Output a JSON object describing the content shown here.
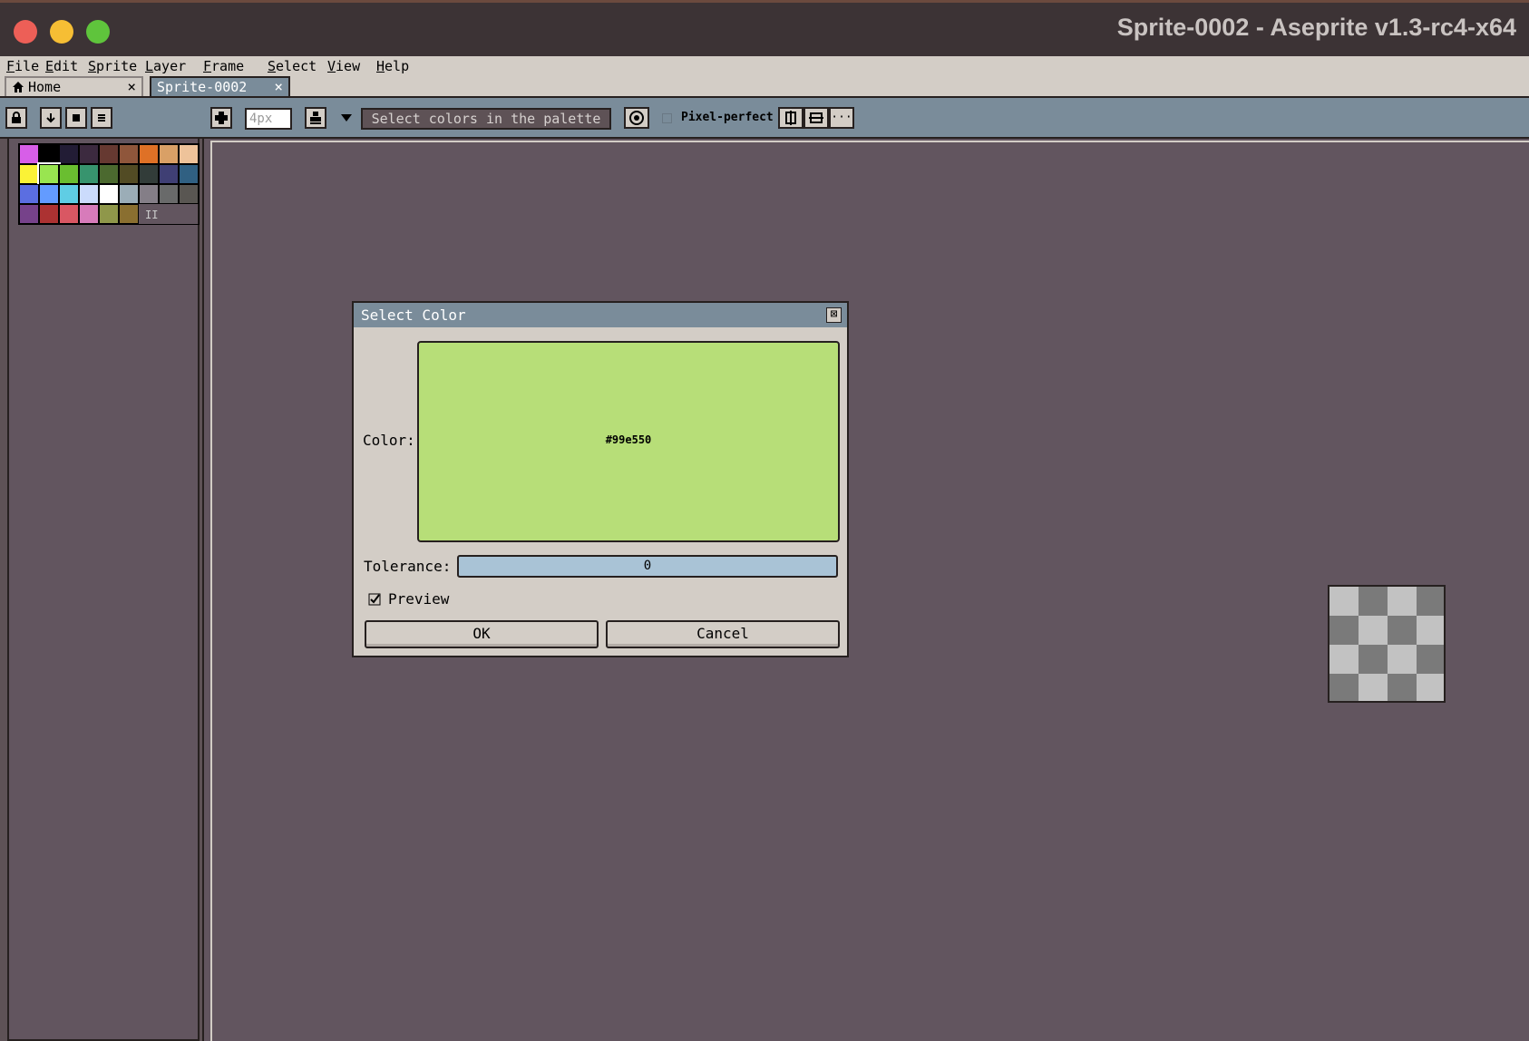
{
  "window": {
    "title": "Sprite-0002 - Aseprite v1.3-rc4-x64",
    "traffic_colors": {
      "close": "#ed5f57",
      "minimize": "#f6be34",
      "maximize": "#5fc43c"
    }
  },
  "menu": {
    "items": [
      "File",
      "Edit",
      "Sprite",
      "Layer",
      "Frame",
      "Select",
      "View",
      "Help"
    ]
  },
  "tabs": [
    {
      "label": "Home",
      "close": "×"
    },
    {
      "label": "Sprite-0002",
      "close": "×"
    }
  ],
  "toolbar": {
    "brush_size_placeholder": "4px",
    "pick_mode": "Select colors in the palette",
    "pixel_perfect_label": "Pixel-perfect",
    "more_label": "···"
  },
  "palette": {
    "colors": [
      "#d75ee8",
      "#000000",
      "#221c35",
      "#3c2a3f",
      "#663931",
      "#8f563b",
      "#df7126",
      "#d9a066",
      "#eec39a",
      "#fbf236",
      "#99e550",
      "#6abe30",
      "#37946e",
      "#4b692f",
      "#524b24",
      "#323c39",
      "#3f3f74",
      "#306082",
      "#5b6ee1",
      "#639bff",
      "#5fcde4",
      "#cbdbfc",
      "#ffffff",
      "#9badb7",
      "#847e87",
      "#696a6a",
      "#595652",
      "#76428a",
      "#ac3232",
      "#d95763",
      "#d77bba",
      "#8f974a",
      "#8a6f30"
    ],
    "more_indicator": "II"
  },
  "dialog": {
    "title": "Select Color",
    "color_label": "Color:",
    "color_hex": "#99e550",
    "swatch_color": "#b7de78",
    "tolerance_label": "Tolerance:",
    "tolerance_value": "0",
    "preview_label": "Preview",
    "preview_checked": true,
    "ok_label": "OK",
    "cancel_label": "Cancel",
    "close_icon": "⊠"
  }
}
